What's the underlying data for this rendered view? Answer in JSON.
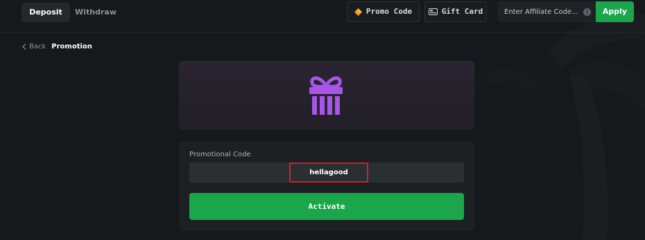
{
  "header": {
    "tabs": [
      {
        "label": "Deposit",
        "active": true
      },
      {
        "label": "Withdraw",
        "active": false
      }
    ],
    "promo_code_label": "Promo Code",
    "gift_card_label": "Gift Card",
    "affiliate": {
      "placeholder": "Enter Affiliate Code...",
      "apply_label": "Apply"
    }
  },
  "breadcrumb": {
    "back_label": "Back",
    "current": "Promotion"
  },
  "promotion": {
    "code_label": "Promotional Code",
    "code_value": "hellagood",
    "activate_label": "Activate"
  },
  "colors": {
    "accent_green": "#1ca64c",
    "gift_purple": "#a855e8",
    "highlight_red": "#d41f2a"
  }
}
